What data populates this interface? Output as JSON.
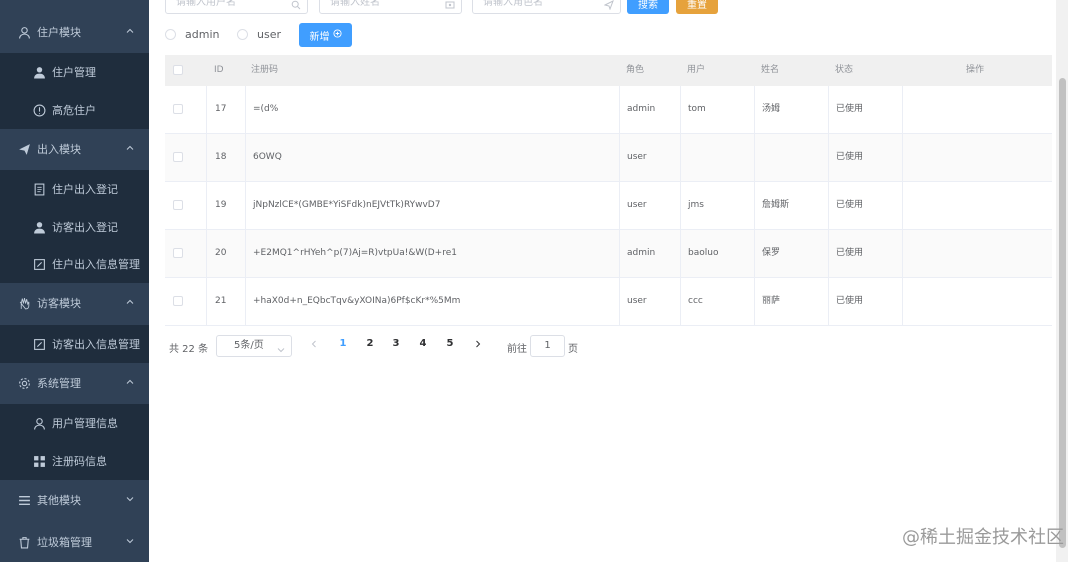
{
  "sidebar": {
    "items": [
      {
        "label": "住户模块",
        "icon": "user-icon",
        "type": "group"
      },
      {
        "label": "住户管理",
        "icon": "person-icon",
        "type": "sub"
      },
      {
        "label": "高危住户",
        "icon": "warning-circle-icon",
        "type": "sub"
      },
      {
        "label": "出入模块",
        "icon": "paper-plane-icon",
        "type": "group"
      },
      {
        "label": "住户出入登记",
        "icon": "document-icon",
        "type": "sub"
      },
      {
        "label": "访客出入登记",
        "icon": "person-icon",
        "type": "sub"
      },
      {
        "label": "住户出入信息管理",
        "icon": "edit-icon",
        "type": "sub"
      },
      {
        "label": "访客模块",
        "icon": "hand-icon",
        "type": "group"
      },
      {
        "label": "访客出入信息管理",
        "icon": "edit-icon",
        "type": "sub"
      },
      {
        "label": "系统管理",
        "icon": "gear-icon",
        "type": "group"
      },
      {
        "label": "用户管理信息",
        "icon": "user-icon",
        "type": "sub"
      },
      {
        "label": "注册码信息",
        "icon": "grid-icon",
        "type": "sub"
      },
      {
        "label": "其他模块",
        "icon": "menu-icon",
        "type": "group"
      },
      {
        "label": "垃圾箱管理",
        "icon": "trash-icon",
        "type": "group"
      }
    ]
  },
  "search": {
    "username_placeholder": "请输入用户名",
    "name_placeholder": "请输入姓名",
    "role_placeholder": "请输入角色名",
    "search_label": "搜索",
    "reset_label": "重置"
  },
  "filter": {
    "radio_admin": "admin",
    "radio_user": "user",
    "add_label": "新增"
  },
  "table": {
    "headers": [
      "ID",
      "注册码",
      "角色",
      "用户",
      "姓名",
      "状态",
      "操作"
    ],
    "rows": [
      {
        "id": "17",
        "code": "=(d%",
        "role": "admin",
        "user": "tom",
        "name": "汤姆",
        "status": "已使用"
      },
      {
        "id": "18",
        "code": "6OWQ",
        "role": "user",
        "user": "",
        "name": "",
        "status": "已使用"
      },
      {
        "id": "19",
        "code": "jNpNzlCE*(GMBE*YiSFdk)nEJVtTk)RYwvD7",
        "role": "user",
        "user": "jms",
        "name": "詹姆斯",
        "status": "已使用"
      },
      {
        "id": "20",
        "code": "+E2MQ1^rHYeh^p(7)Aj=R)vtpUa!&W(D+re1",
        "role": "admin",
        "user": "baoluo",
        "name": "保罗",
        "status": "已使用"
      },
      {
        "id": "21",
        "code": "+haX0d+n_EQbcTqv&yXOINa)6Pf$cKr*%5Mm",
        "role": "user",
        "user": "ccc",
        "name": "丽萨",
        "status": "已使用"
      }
    ]
  },
  "pagination": {
    "total": "共 22 条",
    "page_size": "5条/页",
    "pages": [
      "1",
      "2",
      "3",
      "4",
      "5"
    ],
    "current": "1",
    "goto_label": "前往",
    "goto_value": "1",
    "page_unit": "页"
  },
  "watermark": "@稀土掘金技术社区",
  "colors": {
    "sidebar_bg": "#304156",
    "primary": "#409eff",
    "warning": "#e6a23c"
  }
}
